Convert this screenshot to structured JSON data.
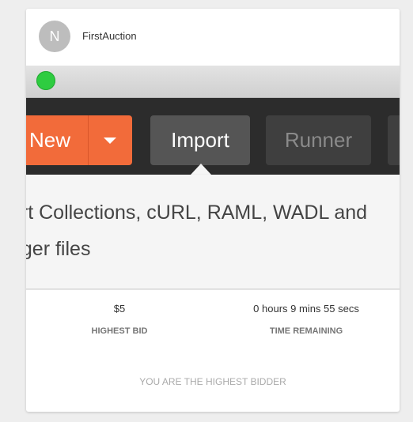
{
  "auction": {
    "avatar_letter": "N",
    "title": "FirstAuction"
  },
  "screenshot": {
    "toolbar": {
      "new_label": "New",
      "import_label": "Import",
      "runner_label": "Runner"
    },
    "tooltip": {
      "line1": "ort Collections, cURL, RAML, WADL and",
      "line2": "gger files"
    }
  },
  "stats": {
    "bid_value": "$5",
    "bid_label": "HIGHEST BID",
    "time_value": "0 hours 9 mins 55 secs",
    "time_label": "TIME REMAINING"
  },
  "status": {
    "message": "YOU ARE THE HIGHEST BIDDER"
  },
  "colors": {
    "accent_new": "#f26b3a",
    "traffic_green": "#2ecc40",
    "avatar_bg": "#bdbdbd"
  },
  "icons": {
    "dropdown": "caret-down-icon",
    "window_control": "green-window-dot-icon"
  }
}
